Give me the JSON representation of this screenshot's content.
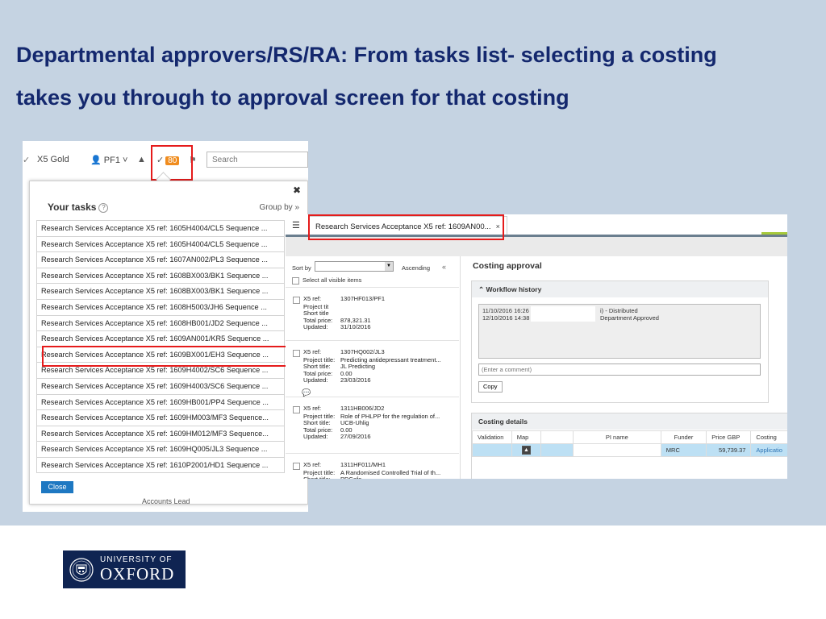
{
  "slide": {
    "title_line1": "Departmental approvers/RS/RA: From tasks list- selecting a costing",
    "title_line2": "takes you through to approval screen for that costing"
  },
  "logo": {
    "line1": "UNIVERSITY OF",
    "line2": "OXFORD"
  },
  "colors": {
    "title": "#14286e",
    "background": "#c5d3e2",
    "highlight": "#e51b1b",
    "badge": "#f08c1e",
    "logo": "#0f2452"
  },
  "topbar": {
    "gold_label": "X5 Gold",
    "user_label": "PF1",
    "tasks_count": "80",
    "search_placeholder": "Search"
  },
  "tasks_panel": {
    "title": "Your tasks",
    "group_by": "Group by",
    "close_label": "Close",
    "items": [
      "Research Services Acceptance X5 ref: 1605H4004/CL5 Sequence ...",
      "Research Services Acceptance X5 ref: 1605H4004/CL5 Sequence ...",
      "Research Services Acceptance X5 ref: 1607AN002/PL3 Sequence ...",
      "Research Services Acceptance X5 ref: 1608BX003/BK1 Sequence ...",
      "Research Services Acceptance X5 ref: 1608BX003/BK1 Sequence ...",
      "Research Services Acceptance X5 ref: 1608H5003/JH6 Sequence ...",
      "Research Services Acceptance X5 ref: 1608HB001/JD2 Sequence ...",
      "Research Services Acceptance X5 ref: 1609AN001/KR5 Sequence ...",
      "Research Services Acceptance X5 ref: 1609BX001/EH3 Sequence ...",
      "Research Services Acceptance X5 ref: 1609H4002/SC6 Sequence ...",
      "Research Services Acceptance X5 ref: 1609H4003/SC6 Sequence ...",
      "Research Services Acceptance X5 ref: 1609HB001/PP4 Sequence ...",
      "Research Services Acceptance X5 ref: 1609HM003/MF3 Sequence...",
      "Research Services Acceptance X5 ref: 1609HM012/MF3 Sequence...",
      "Research Services Acceptance X5 ref: 1609HQ005/JL3 Sequence ...",
      "Research Services Acceptance X5 ref: 1610P2001/HD1 Sequence ..."
    ]
  },
  "background_text": "Accounts Lead",
  "approval": {
    "tab_label": "Research Services Acceptance X5 ref: 1609AN00...",
    "sort_by": "Sort by",
    "ascending": "Ascending",
    "select_all": "Select all visible items",
    "cards": [
      {
        "ref_label": "X5 ref:",
        "ref": "1307HF013/PF1",
        "labels": [
          "Project tit",
          "Short title",
          "Total price:",
          "Updated:"
        ],
        "values": [
          "",
          "",
          "878,321.31",
          "31/10/2016"
        ]
      },
      {
        "ref_label": "X5 ref:",
        "ref": "1307HQ002/JL3",
        "labels": [
          "Project title:",
          "Short title:",
          "Total price:",
          "Updated:"
        ],
        "values": [
          "Predicting antidepressant treatment...",
          "JL Predicting",
          "0.00",
          "23/03/2016"
        ]
      },
      {
        "ref_label": "X5 ref:",
        "ref": "1311HB006/JD2",
        "labels": [
          "Project title:",
          "Short title:",
          "Total price:",
          "Updated:"
        ],
        "values": [
          "Role of PHLPP for the regulation of...",
          "UCB-Uhlig",
          "0.00",
          "27/09/2016"
        ]
      },
      {
        "ref_label": "X5 ref:",
        "ref": "1311HF011/MH1",
        "labels": [
          "Project title:",
          "Short title:"
        ],
        "values": [
          "A Randomised Controlled Trial of th...",
          "PDCafe"
        ]
      }
    ],
    "costing_title": "Costing approval",
    "workflow_title": "Workflow history",
    "workflow": [
      {
        "date": "11/10/2016 16:26",
        "status": "i) - Distributed"
      },
      {
        "date": "12/10/2016 14:38",
        "status": "Department Approved"
      }
    ],
    "comment_placeholder": "(Enter a comment)",
    "copy_label": "Copy",
    "costing_details_title": "Costing details",
    "columns": [
      "Validation",
      "Map",
      "",
      "PI name",
      "Funder",
      "Price GBP",
      "Costing"
    ],
    "row": {
      "funder": "MRC",
      "price": "59,739.37",
      "costing": "Applicatio"
    }
  }
}
